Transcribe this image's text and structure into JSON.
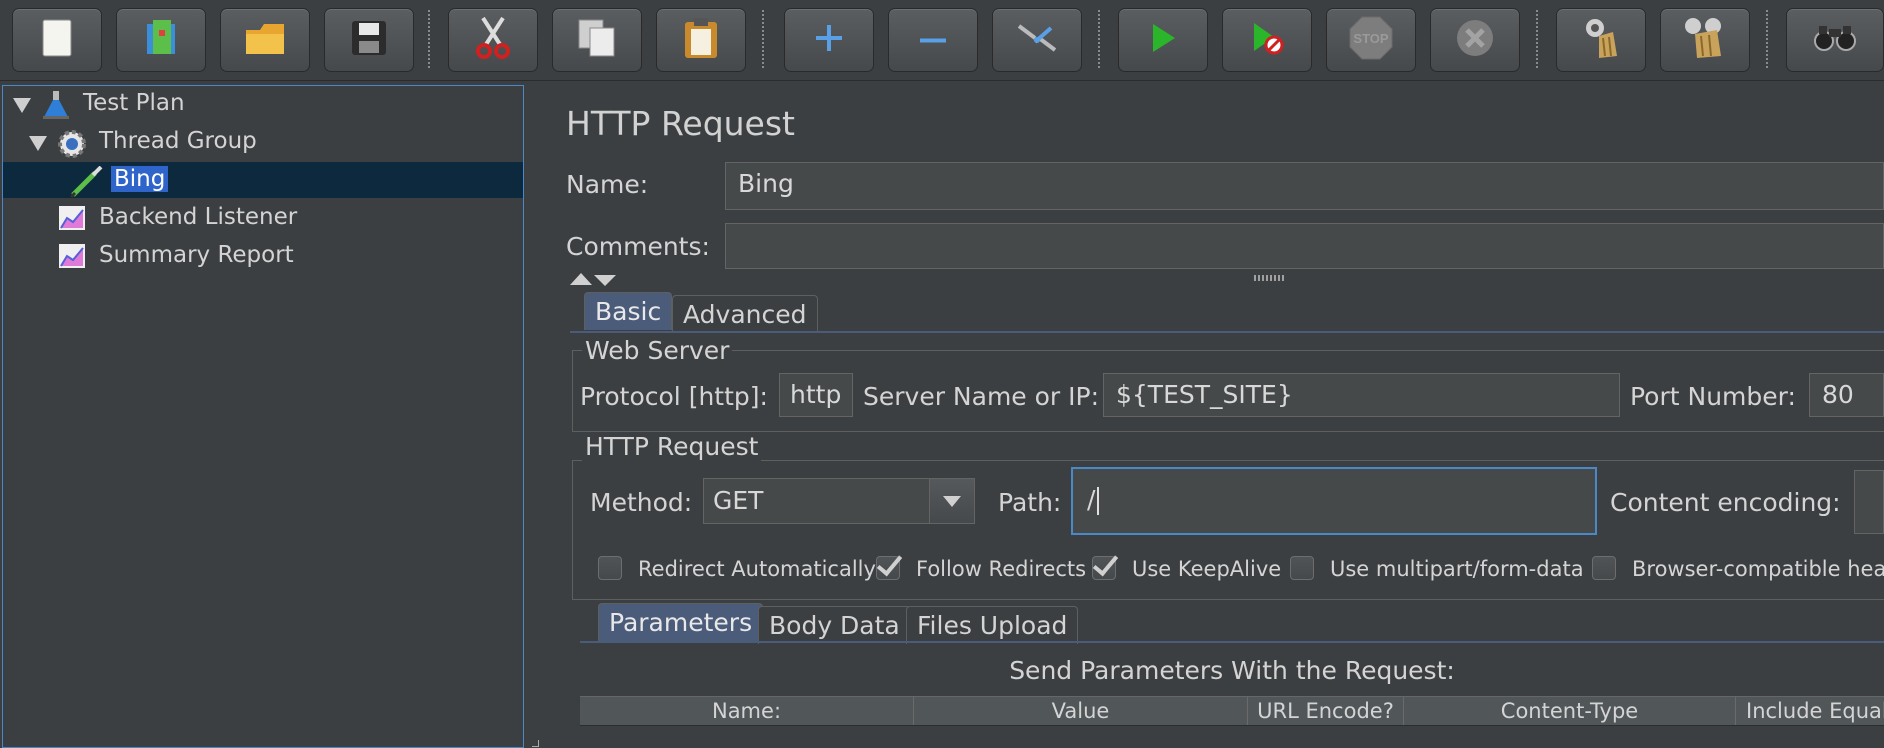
{
  "toolbar": {
    "buttons": [
      {
        "name": "new-icon"
      },
      {
        "name": "templates-icon"
      },
      {
        "name": "open-icon"
      },
      {
        "name": "save-icon"
      },
      {
        "name": "cut-icon"
      },
      {
        "name": "copy-icon"
      },
      {
        "name": "paste-icon"
      },
      {
        "name": "expand-icon"
      },
      {
        "name": "collapse-icon"
      },
      {
        "name": "toggle-icon"
      },
      {
        "name": "start-icon"
      },
      {
        "name": "start-no-pauses-icon"
      },
      {
        "name": "stop-icon"
      },
      {
        "name": "shutdown-icon"
      },
      {
        "name": "clear-icon"
      },
      {
        "name": "clear-all-icon"
      },
      {
        "name": "search-icon"
      }
    ],
    "stop_label": "STOP"
  },
  "tree": {
    "items": [
      {
        "label": "Test Plan"
      },
      {
        "label": "Thread Group"
      },
      {
        "label": "Bing"
      },
      {
        "label": "Backend Listener"
      },
      {
        "label": "Summary Report"
      }
    ]
  },
  "panel": {
    "title": "HTTP Request",
    "name_label": "Name:",
    "name_value": "Bing",
    "comments_label": "Comments:",
    "comments_value": "",
    "tabs": [
      "Basic",
      "Advanced"
    ],
    "web_server": {
      "title": "Web Server",
      "protocol_label": "Protocol [http]:",
      "protocol_value": "http",
      "server_label": "Server Name or IP:",
      "server_value": "${TEST_SITE}",
      "port_label": "Port Number:",
      "port_value": "80"
    },
    "http_request": {
      "title": "HTTP Request",
      "method_label": "Method:",
      "method_value": "GET",
      "path_label": "Path:",
      "path_value": "/",
      "encoding_label": "Content encoding:",
      "encoding_value": ""
    },
    "checkboxes": [
      {
        "label": "Redirect Automatically",
        "checked": false
      },
      {
        "label": "Follow Redirects",
        "checked": true
      },
      {
        "label": "Use KeepAlive",
        "checked": true
      },
      {
        "label": "Use multipart/form-data",
        "checked": false
      },
      {
        "label": "Browser-compatible headers",
        "checked": false
      }
    ],
    "sub_tabs": [
      "Parameters",
      "Body Data",
      "Files Upload"
    ],
    "params_title": "Send Parameters With the Request:",
    "columns": [
      "Name:",
      "Value",
      "URL Encode?",
      "Content-Type",
      "Include Equals?"
    ]
  },
  "colors": {
    "background": "#3c3f41",
    "selection": "#2f65ca",
    "focus_border": "#4a88c7",
    "active_tab": "#4b5b7a"
  }
}
